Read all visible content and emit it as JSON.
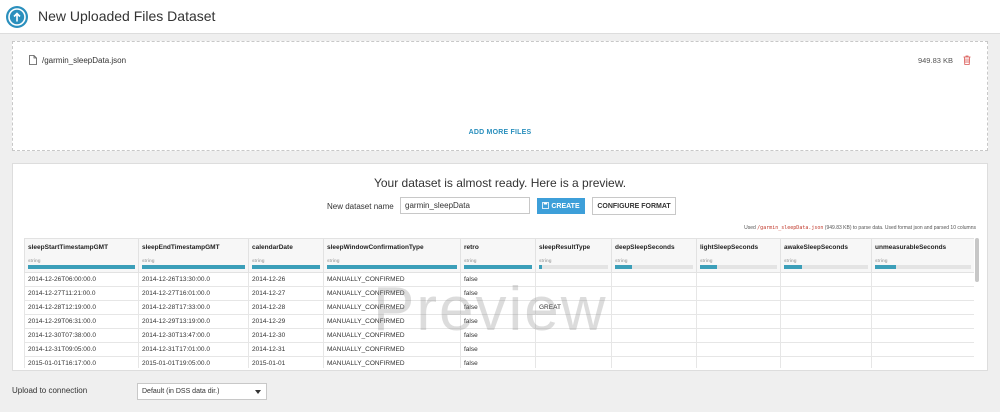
{
  "header": {
    "title": "New Uploaded Files Dataset",
    "icon": "upload-icon"
  },
  "upload": {
    "file_name": "/garmin_sleepData.json",
    "file_size": "949.83 KB",
    "add_more_label": "ADD MORE FILES"
  },
  "preview": {
    "heading": "Your dataset is almost ready. Here is a preview.",
    "name_label": "New dataset name",
    "name_value": "garmin_sleepData",
    "create_label": "CREATE",
    "configure_label": "CONFIGURE FORMAT",
    "used_prefix": "Used",
    "used_file": "/garmin_sleepData.json",
    "used_suffix": "(949.83 KB) to parse data. Used format json and parsed 10 columns",
    "watermark": "Preview"
  },
  "columns": [
    {
      "name": "sleepStartTimestampGMT",
      "type": "string",
      "fill": 1.0
    },
    {
      "name": "sleepEndTimestampGMT",
      "type": "string",
      "fill": 1.0
    },
    {
      "name": "calendarDate",
      "type": "string",
      "fill": 1.0
    },
    {
      "name": "sleepWindowConfirmationType",
      "type": "string",
      "fill": 1.0
    },
    {
      "name": "retro",
      "type": "string",
      "fill": 1.0
    },
    {
      "name": "sleepResultType",
      "type": "string",
      "fill": 0.05
    },
    {
      "name": "deepSleepSeconds",
      "type": "string",
      "fill": 0.22
    },
    {
      "name": "lightSleepSeconds",
      "type": "string",
      "fill": 0.22
    },
    {
      "name": "awakeSleepSeconds",
      "type": "string",
      "fill": 0.22
    },
    {
      "name": "unmeasurableSeconds",
      "type": "string",
      "fill": 0.22
    }
  ],
  "rows": [
    [
      "2014-12-26T06:00:00.0",
      "2014-12-26T13:30:00.0",
      "2014-12-26",
      "MANUALLY_CONFIRMED",
      "false",
      "",
      "",
      "",
      "",
      ""
    ],
    [
      "2014-12-27T11:21:00.0",
      "2014-12-27T16:01:00.0",
      "2014-12-27",
      "MANUALLY_CONFIRMED",
      "false",
      "",
      "",
      "",
      "",
      ""
    ],
    [
      "2014-12-28T12:19:00.0",
      "2014-12-28T17:33:00.0",
      "2014-12-28",
      "MANUALLY_CONFIRMED",
      "false",
      "GREAT",
      "",
      "",
      "",
      ""
    ],
    [
      "2014-12-29T06:31:00.0",
      "2014-12-29T13:19:00.0",
      "2014-12-29",
      "MANUALLY_CONFIRMED",
      "false",
      "",
      "",
      "",
      "",
      ""
    ],
    [
      "2014-12-30T07:38:00.0",
      "2014-12-30T13:47:00.0",
      "2014-12-30",
      "MANUALLY_CONFIRMED",
      "false",
      "",
      "",
      "",
      "",
      ""
    ],
    [
      "2014-12-31T09:05:00.0",
      "2014-12-31T17:01:00.0",
      "2014-12-31",
      "MANUALLY_CONFIRMED",
      "false",
      "",
      "",
      "",
      "",
      ""
    ],
    [
      "2015-01-01T16:17:00.0",
      "2015-01-01T19:05:00.0",
      "2015-01-01",
      "MANUALLY_CONFIRMED",
      "false",
      "",
      "",
      "",
      "",
      ""
    ]
  ],
  "connection": {
    "label": "Upload to connection",
    "value": "Default (in DSS data dir.)"
  },
  "colors": {
    "accent": "#3d9fd9",
    "bar": "#3c9fb9",
    "link": "#2a8fbd",
    "error": "#c0392b"
  }
}
